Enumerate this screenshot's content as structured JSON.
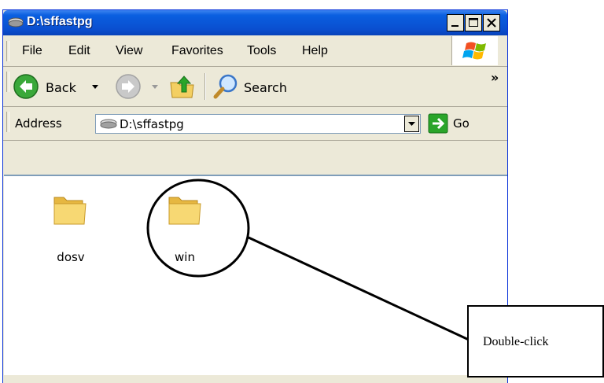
{
  "window": {
    "title": "D:\\sffastpg"
  },
  "menu": {
    "items": [
      "File",
      "Edit",
      "View",
      "Favorites",
      "Tools",
      "Help"
    ]
  },
  "toolbar": {
    "back_label": "Back",
    "search_label": "Search",
    "more_chevron": "»"
  },
  "address": {
    "label": "Address",
    "value": "D:\\sffastpg",
    "go_label": "Go"
  },
  "folders": [
    {
      "name": "dosv"
    },
    {
      "name": "win"
    }
  ],
  "annotation": {
    "text": "Double-click"
  },
  "colors": {
    "titlebar": "#0a4fd0",
    "chrome": "#ece9d8",
    "folder": "#f3d36b",
    "go_arrow": "#2aa52a",
    "back_arrow": "#3aa83a"
  }
}
